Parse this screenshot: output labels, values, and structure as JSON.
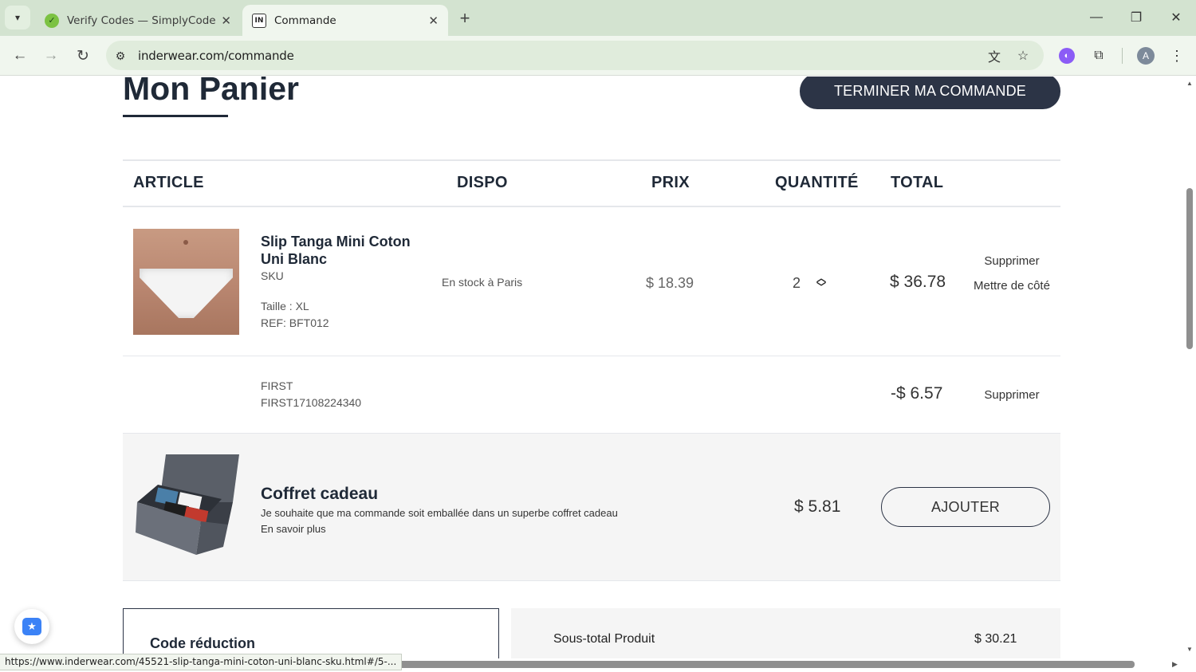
{
  "browser": {
    "tabs": [
      {
        "title": "Verify Codes — SimplyCodes",
        "icon": "simplycodes-favicon",
        "active": false
      },
      {
        "title": "Commande",
        "icon": "inderwear-favicon",
        "active": true
      }
    ],
    "url": "inderwear.com/commande",
    "profile_initial": "A",
    "status_url": "https://www.inderwear.com/45521-slip-tanga-mini-coton-uni-blanc-sku.html#/5-..."
  },
  "page": {
    "title": "Mon Panier",
    "checkout_button": "TERMINER MA COMMANDE",
    "table_headers": {
      "article": "ARTICLE",
      "dispo": "DISPO",
      "prix": "PRIX",
      "quantite": "QUANTITÉ",
      "total": "TOTAL"
    },
    "item": {
      "name": "Slip Tanga Mini Coton Uni Blanc",
      "sku_label": "SKU",
      "size": "Taille : XL",
      "ref": "REF: BFT012",
      "availability": "En stock à Paris",
      "unit_price": "$ 18.39",
      "quantity": "2",
      "total": "$ 36.78",
      "remove": "Supprimer",
      "save_for_later": "Mettre de côté"
    },
    "promo": {
      "label": "FIRST",
      "code": "FIRST17108224340",
      "amount": "-$ 6.57",
      "remove": "Supprimer"
    },
    "gift": {
      "title": "Coffret cadeau",
      "description": "Je souhaite que ma commande soit emballée dans un superbe coffret cadeau",
      "more": "En savoir plus",
      "price": "$ 5.81",
      "button": "AJOUTER"
    },
    "coupon": {
      "title": "Code réduction"
    },
    "summary": {
      "subtotal_label": "Sous-total Produit",
      "subtotal_value": "$ 30.21"
    }
  },
  "colors": {
    "accent": "#2c3446",
    "chrome": "#d3e3d0",
    "toolbar": "#f0f6ee"
  }
}
